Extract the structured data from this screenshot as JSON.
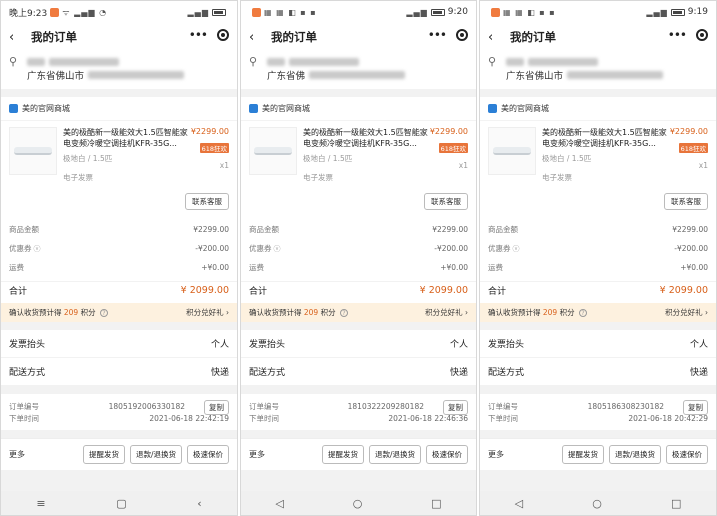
{
  "screens": [
    {
      "status_time": "晚上9:23",
      "status_glyphs": "ᯤ ▂▄▆ ◔",
      "title": "我的订单",
      "address_line1_prefix": "",
      "address_line2_prefix": "广东省佛山市",
      "shop_name": "美的官网商城",
      "goods_title": "美的极酷新一级能效大1.5匹智能家电变频冷暖空调挂机KFR-35G...",
      "goods_spec": "极地白 / 1.5匹",
      "einvoice": "电子发票",
      "price": "¥2299.00",
      "tag": "618狂欢",
      "qty": "x1",
      "cs_button": "联系客服",
      "rows": [
        {
          "label": "商品金额",
          "value": "¥2299.00"
        },
        {
          "label": "优惠券",
          "value": "-¥200.00"
        },
        {
          "label": "运费",
          "value": "+¥0.00"
        }
      ],
      "total_label": "合计",
      "total_value": "¥ 2099.00",
      "points_prefix": "确认收货预计得",
      "points_num": "209",
      "points_suffix": "积分",
      "points_link": "积分兑好礼 ›",
      "invoice_label": "发票抬头",
      "invoice_value": "个人",
      "ship_label": "配送方式",
      "ship_value": "快递",
      "order_no_label": "订单编号",
      "order_no": "1805192006330182",
      "copy": "复制",
      "order_time_label": "下单时间",
      "order_time": "2021-06-18 22:42:19",
      "more": "更多",
      "actions": [
        "提醒发货",
        "退款/退换货",
        "极速保价"
      ],
      "nav": [
        "≡",
        "▢",
        "‹"
      ]
    },
    {
      "status_time": "",
      "status_glyphs": "▦ ▦ ◧ ▪ ▪",
      "status_right": "9:20",
      "title": "我的订单",
      "address_line1_prefix": "",
      "address_line2_prefix": "广东省佛",
      "shop_name": "美的官网商城",
      "goods_title": "美的极酷新一级能效大1.5匹智能家电变频冷暖空调挂机KFR-35G...",
      "goods_spec": "极地白 / 1.5匹",
      "einvoice": "电子发票",
      "price": "¥2299.00",
      "tag": "618狂欢",
      "qty": "x1",
      "cs_button": "联系客服",
      "rows": [
        {
          "label": "商品金额",
          "value": "¥2299.00"
        },
        {
          "label": "优惠券",
          "value": "-¥200.00"
        },
        {
          "label": "运费",
          "value": "+¥0.00"
        }
      ],
      "total_label": "合计",
      "total_value": "¥ 2099.00",
      "points_prefix": "确认收货预计得",
      "points_num": "209",
      "points_suffix": "积分",
      "points_link": "积分兑好礼 ›",
      "invoice_label": "发票抬头",
      "invoice_value": "个人",
      "ship_label": "配送方式",
      "ship_value": "快递",
      "order_no_label": "订单编号",
      "order_no": "1810322209280182",
      "copy": "复制",
      "order_time_label": "下单时间",
      "order_time": "2021-06-18 22:46:36",
      "more": "更多",
      "actions": [
        "提醒发货",
        "退款/退换货",
        "极速保价"
      ],
      "nav": [
        "◁",
        "○",
        "□"
      ]
    },
    {
      "status_time": "",
      "status_glyphs": "▦ ▦ ◧ ▪ ▪",
      "status_right": "9:19",
      "title": "我的订单",
      "address_line1_prefix": "",
      "address_line2_prefix": "广东省佛山市",
      "shop_name": "美的官网商城",
      "goods_title": "美的极酷新一级能效大1.5匹智能家电变频冷暖空调挂机KFR-35G...",
      "goods_spec": "极地白 / 1.5匹",
      "einvoice": "电子发票",
      "price": "¥2299.00",
      "tag": "618狂欢",
      "qty": "x1",
      "cs_button": "联系客服",
      "rows": [
        {
          "label": "商品金额",
          "value": "¥2299.00"
        },
        {
          "label": "优惠券",
          "value": "-¥200.00"
        },
        {
          "label": "运费",
          "value": "+¥0.00"
        }
      ],
      "total_label": "合计",
      "total_value": "¥ 2099.00",
      "points_prefix": "确认收货预计得",
      "points_num": "209",
      "points_suffix": "积分",
      "points_link": "积分兑好礼 ›",
      "invoice_label": "发票抬头",
      "invoice_value": "个人",
      "ship_label": "配送方式",
      "ship_value": "快递",
      "order_no_label": "订单编号",
      "order_no": "1805186308230182",
      "copy": "复制",
      "order_time_label": "下单时间",
      "order_time": "2021-06-18 20:42:29",
      "more": "更多",
      "actions": [
        "提醒发货",
        "退款/退换货",
        "极速保价"
      ],
      "nav": [
        "◁",
        "○",
        "□"
      ]
    }
  ]
}
